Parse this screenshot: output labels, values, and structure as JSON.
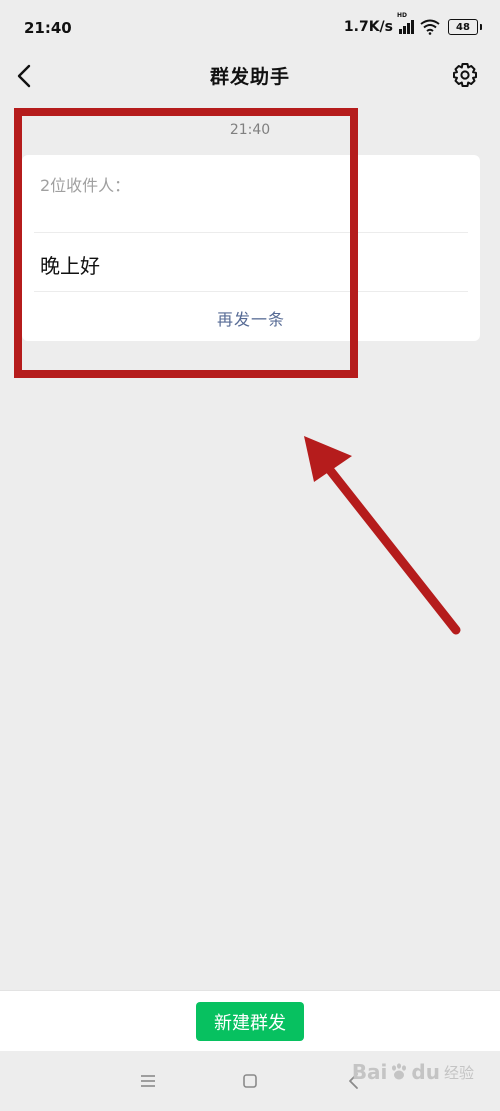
{
  "status_bar": {
    "time": "21:40",
    "net_speed": "1.7K/s",
    "hd_label": "HD",
    "battery": "48",
    "icons": [
      "signal-icon",
      "wifi-icon",
      "battery-icon"
    ]
  },
  "nav": {
    "title": "群发助手",
    "back_icon": "back-chevron-icon",
    "settings_icon": "gear-icon"
  },
  "message_group": {
    "timestamp": "21:40",
    "recipients": "2位收件人：",
    "content": "晚上好",
    "resend_label": "再发一条"
  },
  "bottom": {
    "new_button_label": "新建群发",
    "button_color": "#07c160"
  },
  "system_nav": {
    "icons": [
      "menu-icon",
      "home-icon",
      "back-icon"
    ]
  },
  "watermark": {
    "brand_a": "Bai",
    "brand_b": "du",
    "sub": "经验"
  },
  "annotation": {
    "highlight_color": "#b51c1c"
  }
}
